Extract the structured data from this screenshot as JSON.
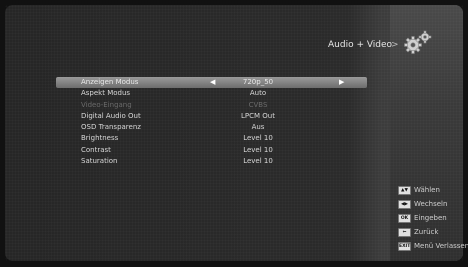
{
  "header": {
    "title": "Audio + Video",
    "chevron": ">"
  },
  "menu": {
    "items": [
      {
        "label": "Anzeigen Modus",
        "value": "720p_50",
        "state": "selected"
      },
      {
        "label": "Aspekt Modus",
        "value": "Auto",
        "state": "normal"
      },
      {
        "label": "Video-Eingang",
        "value": "CVBS",
        "state": "disabled"
      },
      {
        "label": "Digital Audio Out",
        "value": "LPCM Out",
        "state": "normal"
      },
      {
        "label": "OSD Transparenz",
        "value": "Aus",
        "state": "normal"
      },
      {
        "label": "Brightness",
        "value": "Level 10",
        "state": "normal"
      },
      {
        "label": "Contrast",
        "value": "Level 10",
        "state": "normal"
      },
      {
        "label": "Saturation",
        "value": "Level 10",
        "state": "normal"
      }
    ],
    "arrow_left": "◀",
    "arrow_right": "▶"
  },
  "legend": [
    {
      "key_icon": "up-down-key-icon",
      "key": "▲▼",
      "label": "Wählen"
    },
    {
      "key_icon": "left-right-key-icon",
      "key": "◀▶",
      "label": "Wechseln"
    },
    {
      "key_icon": "ok-key-icon",
      "key": "OK",
      "label": "Eingeben"
    },
    {
      "key_icon": "back-key-icon",
      "key": "⇐",
      "label": "Zurück"
    },
    {
      "key_icon": "exit-key-icon",
      "key": "EXIT",
      "label": "Menü Verlassen"
    }
  ]
}
